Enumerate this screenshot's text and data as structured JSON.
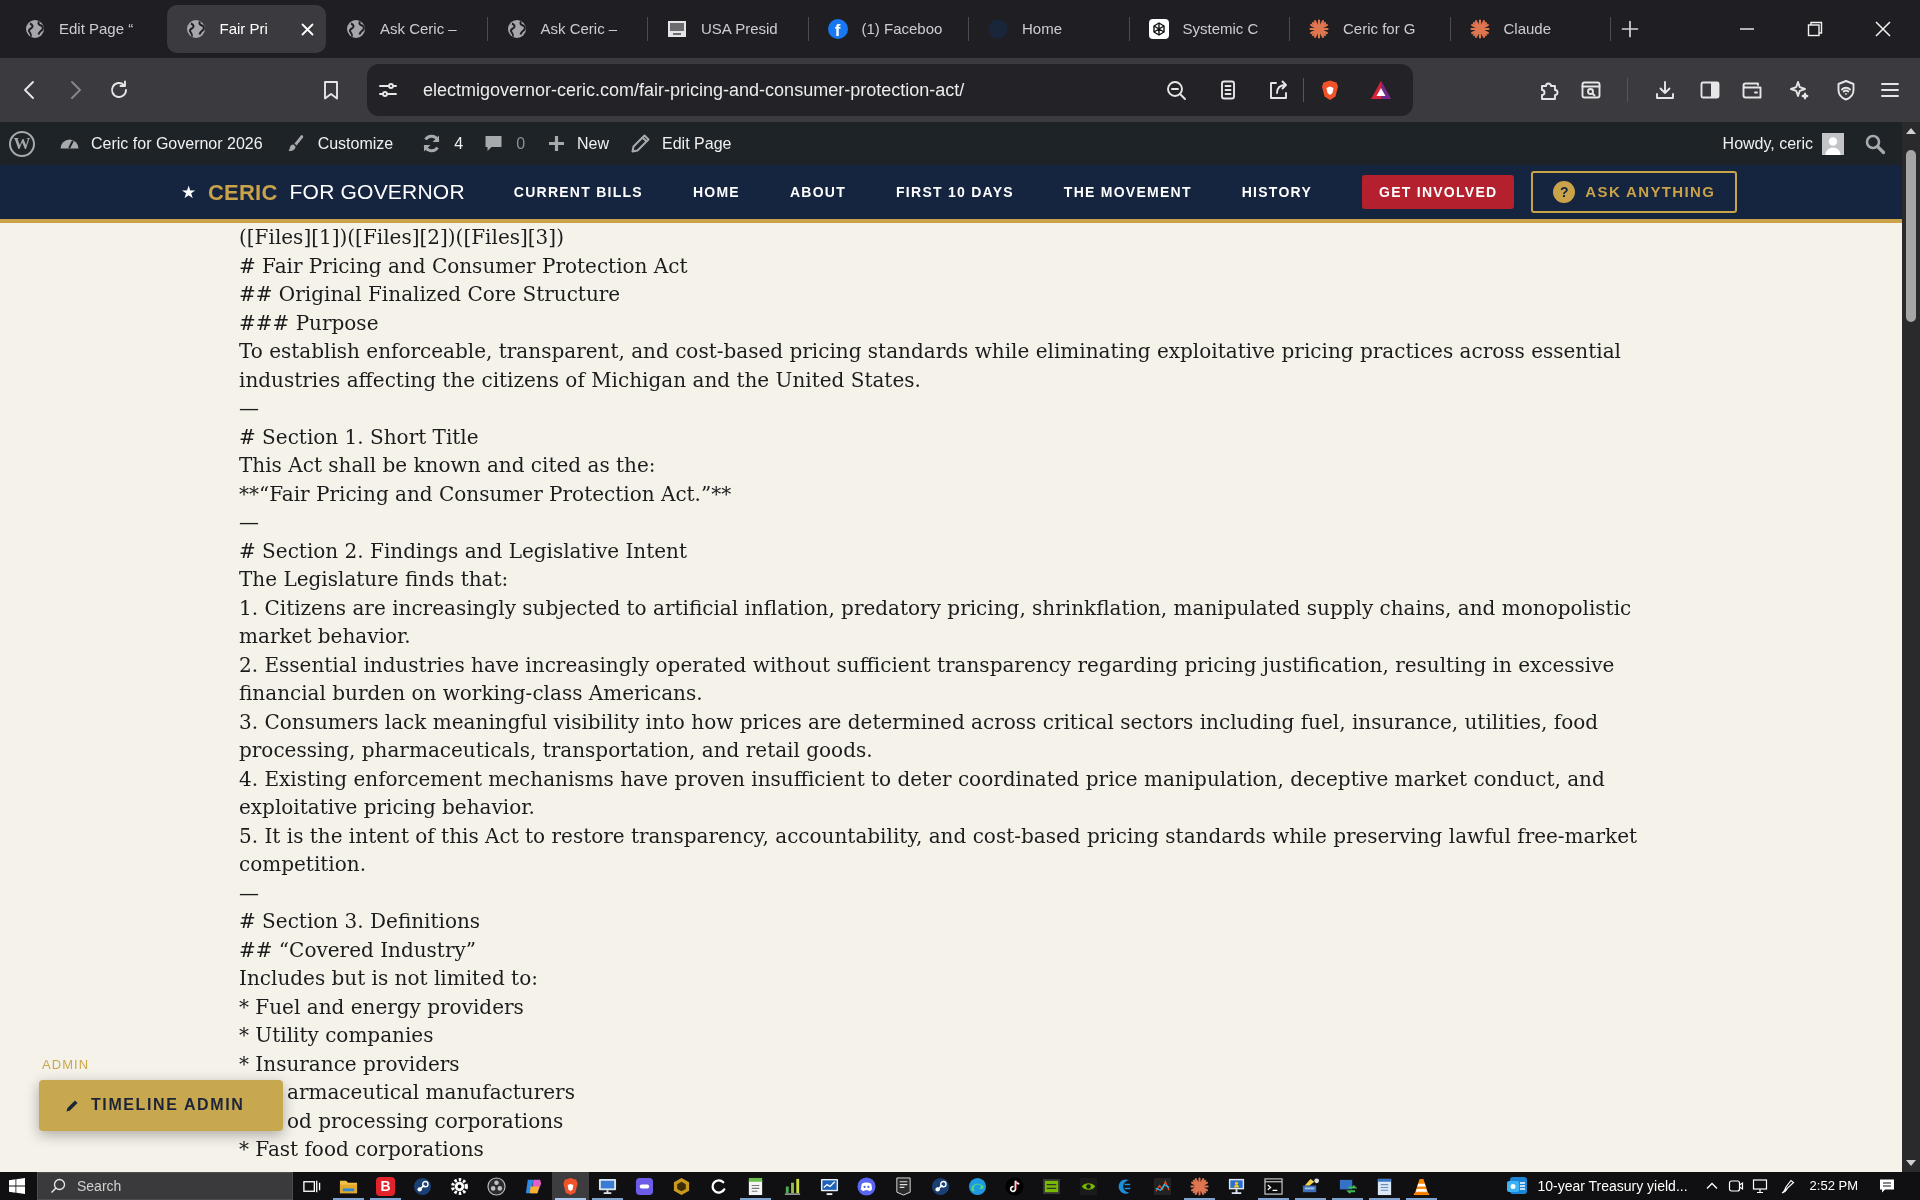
{
  "tabs": [
    {
      "title": "Edit Page “",
      "selected": false,
      "kind": "globe"
    },
    {
      "title": "Fair Pri",
      "selected": true,
      "kind": "globe"
    },
    {
      "title": "Ask Ceric –",
      "selected": false,
      "kind": "globe"
    },
    {
      "title": "Ask Ceric –",
      "selected": false,
      "kind": "globe"
    },
    {
      "title": "USA Presid",
      "selected": false,
      "kind": "picture"
    },
    {
      "title": "(1) Faceboo",
      "selected": false,
      "kind": "letter",
      "icon_letter": "f"
    },
    {
      "title": "Home",
      "selected": false,
      "kind": "dark_disc"
    },
    {
      "title": "Systemic C",
      "selected": false,
      "kind": "knot"
    },
    {
      "title": "Ceric for G",
      "selected": false,
      "kind": "starburst"
    },
    {
      "title": "Claude",
      "selected": false,
      "kind": "starburst"
    }
  ],
  "address_bar": {
    "url": "electmigovernor-ceric.com/fair-pricing-and-consumer-protection-act/"
  },
  "admin_bar": {
    "logo_letter": "W",
    "site_name": "Ceric for Governor 2026",
    "customize": "Customize",
    "updates": "4",
    "comments": "0",
    "new": "New",
    "edit": "Edit Page",
    "greeting": "Howdy, ceric"
  },
  "site_header": {
    "logo": {
      "star": "★",
      "name": "CERIC",
      "tagline": "FOR GOVERNOR"
    },
    "nav": [
      {
        "label": "CURRENT BILLS",
        "kind": "link"
      },
      {
        "label": "HOME",
        "kind": "link"
      },
      {
        "label": "ABOUT",
        "kind": "link"
      },
      {
        "label": "FIRST 10 DAYS",
        "kind": "link"
      },
      {
        "label": "THE MOVEMENT",
        "kind": "link"
      },
      {
        "label": "HISTORY",
        "kind": "link"
      },
      {
        "label": "GET INVOLVED",
        "kind": "cta"
      },
      {
        "label": "ASK ANYTHING",
        "kind": "ask",
        "icon_glyph": "?"
      }
    ]
  },
  "content": {
    "lines": [
      "([Files][1])([Files][2])([Files][3])",
      "# Fair Pricing and Consumer Protection Act",
      "## Original Finalized Core Structure",
      "### Purpose",
      "To establish enforceable, transparent, and cost-based pricing standards while eliminating exploitative pricing practices across essential industries affecting the citizens of Michigan and the United States.",
      "—",
      "# Section 1. Short Title",
      "This Act shall be known and cited as the:",
      "**“Fair Pricing and Consumer Protection Act.”**",
      "—",
      "# Section 2. Findings and Legislative Intent",
      "The Legislature finds that:",
      "1. Citizens are increasingly subjected to artificial inflation, predatory pricing, shrinkflation, manipulated supply chains, and monopolistic market behavior.",
      "2. Essential industries have increasingly operated without sufficient transparency regarding pricing justification, resulting in excessive financial burden on working-class Americans.",
      "3. Consumers lack meaningful visibility into how prices are determined across critical sectors including fuel, insurance, utilities, food processing, pharmaceuticals, transportation, and retail goods.",
      "4. Existing enforcement mechanisms have proven insufficient to deter coordinated price manipulation, deceptive market conduct, and exploitative pricing behavior.",
      "5. It is the intent of this Act to restore transparency, accountability, and cost-based pricing standards while preserving lawful free-market competition.",
      "—",
      "# Section 3. Definitions",
      "## “Covered Industry”",
      "Includes but is not limited to:",
      "* Fuel and energy providers",
      "* Utility companies",
      "* Insurance providers",
      "armaceutical manufacturers",
      "od processing corporations",
      "* Fast food corporations"
    ]
  },
  "admin_widget": {
    "heading": "ADMIN",
    "button": "TIMELINE ADMIN"
  },
  "taskbar": {
    "placeholder": "Search",
    "apps": [
      {
        "kind": "task_view",
        "running": false,
        "active": false
      },
      {
        "kind": "folder",
        "running": true,
        "active": false
      },
      {
        "kind": "letter_tile",
        "label": "B",
        "running": true,
        "active": false
      },
      {
        "kind": "disc",
        "running": false,
        "active": false
      },
      {
        "kind": "gear",
        "running": false,
        "active": false
      },
      {
        "kind": "lens",
        "running": false,
        "active": false
      },
      {
        "kind": "ribbon",
        "running": false,
        "active": false
      },
      {
        "kind": "shield_badge",
        "running": true,
        "active": true
      },
      {
        "kind": "monitor",
        "running": true,
        "active": false
      },
      {
        "kind": "tile",
        "running": false,
        "active": false
      },
      {
        "kind": "hexagon",
        "running": false,
        "active": false
      },
      {
        "kind": "arc",
        "running": false,
        "active": false
      },
      {
        "kind": "notepad",
        "running": true,
        "active": false
      },
      {
        "kind": "bar_chart",
        "running": false,
        "active": false
      },
      {
        "kind": "monitor_chart",
        "running": false,
        "active": false
      },
      {
        "kind": "gamepad",
        "running": false,
        "active": false
      },
      {
        "kind": "badge",
        "running": false,
        "active": false
      },
      {
        "kind": "disc",
        "running": false,
        "active": false
      },
      {
        "kind": "swirl",
        "running": false,
        "active": false
      },
      {
        "kind": "music_note",
        "running": false,
        "active": false
      },
      {
        "kind": "box",
        "running": false,
        "active": false
      },
      {
        "kind": "eye",
        "running": false,
        "active": false
      },
      {
        "kind": "crescent",
        "running": false,
        "active": false
      },
      {
        "kind": "graph",
        "running": false,
        "active": false
      },
      {
        "kind": "starburst",
        "running": true,
        "active": false
      },
      {
        "kind": "computer",
        "running": false,
        "active": false
      },
      {
        "kind": "terminal",
        "running": true,
        "active": false
      },
      {
        "kind": "scanner",
        "running": true,
        "active": false
      },
      {
        "kind": "sync_arrows",
        "running": true,
        "active": false
      },
      {
        "kind": "notebook",
        "running": true,
        "active": false
      },
      {
        "kind": "cone",
        "running": true,
        "active": false
      }
    ],
    "news": "10-year Treasury yield...",
    "time": "2:52 PM"
  }
}
